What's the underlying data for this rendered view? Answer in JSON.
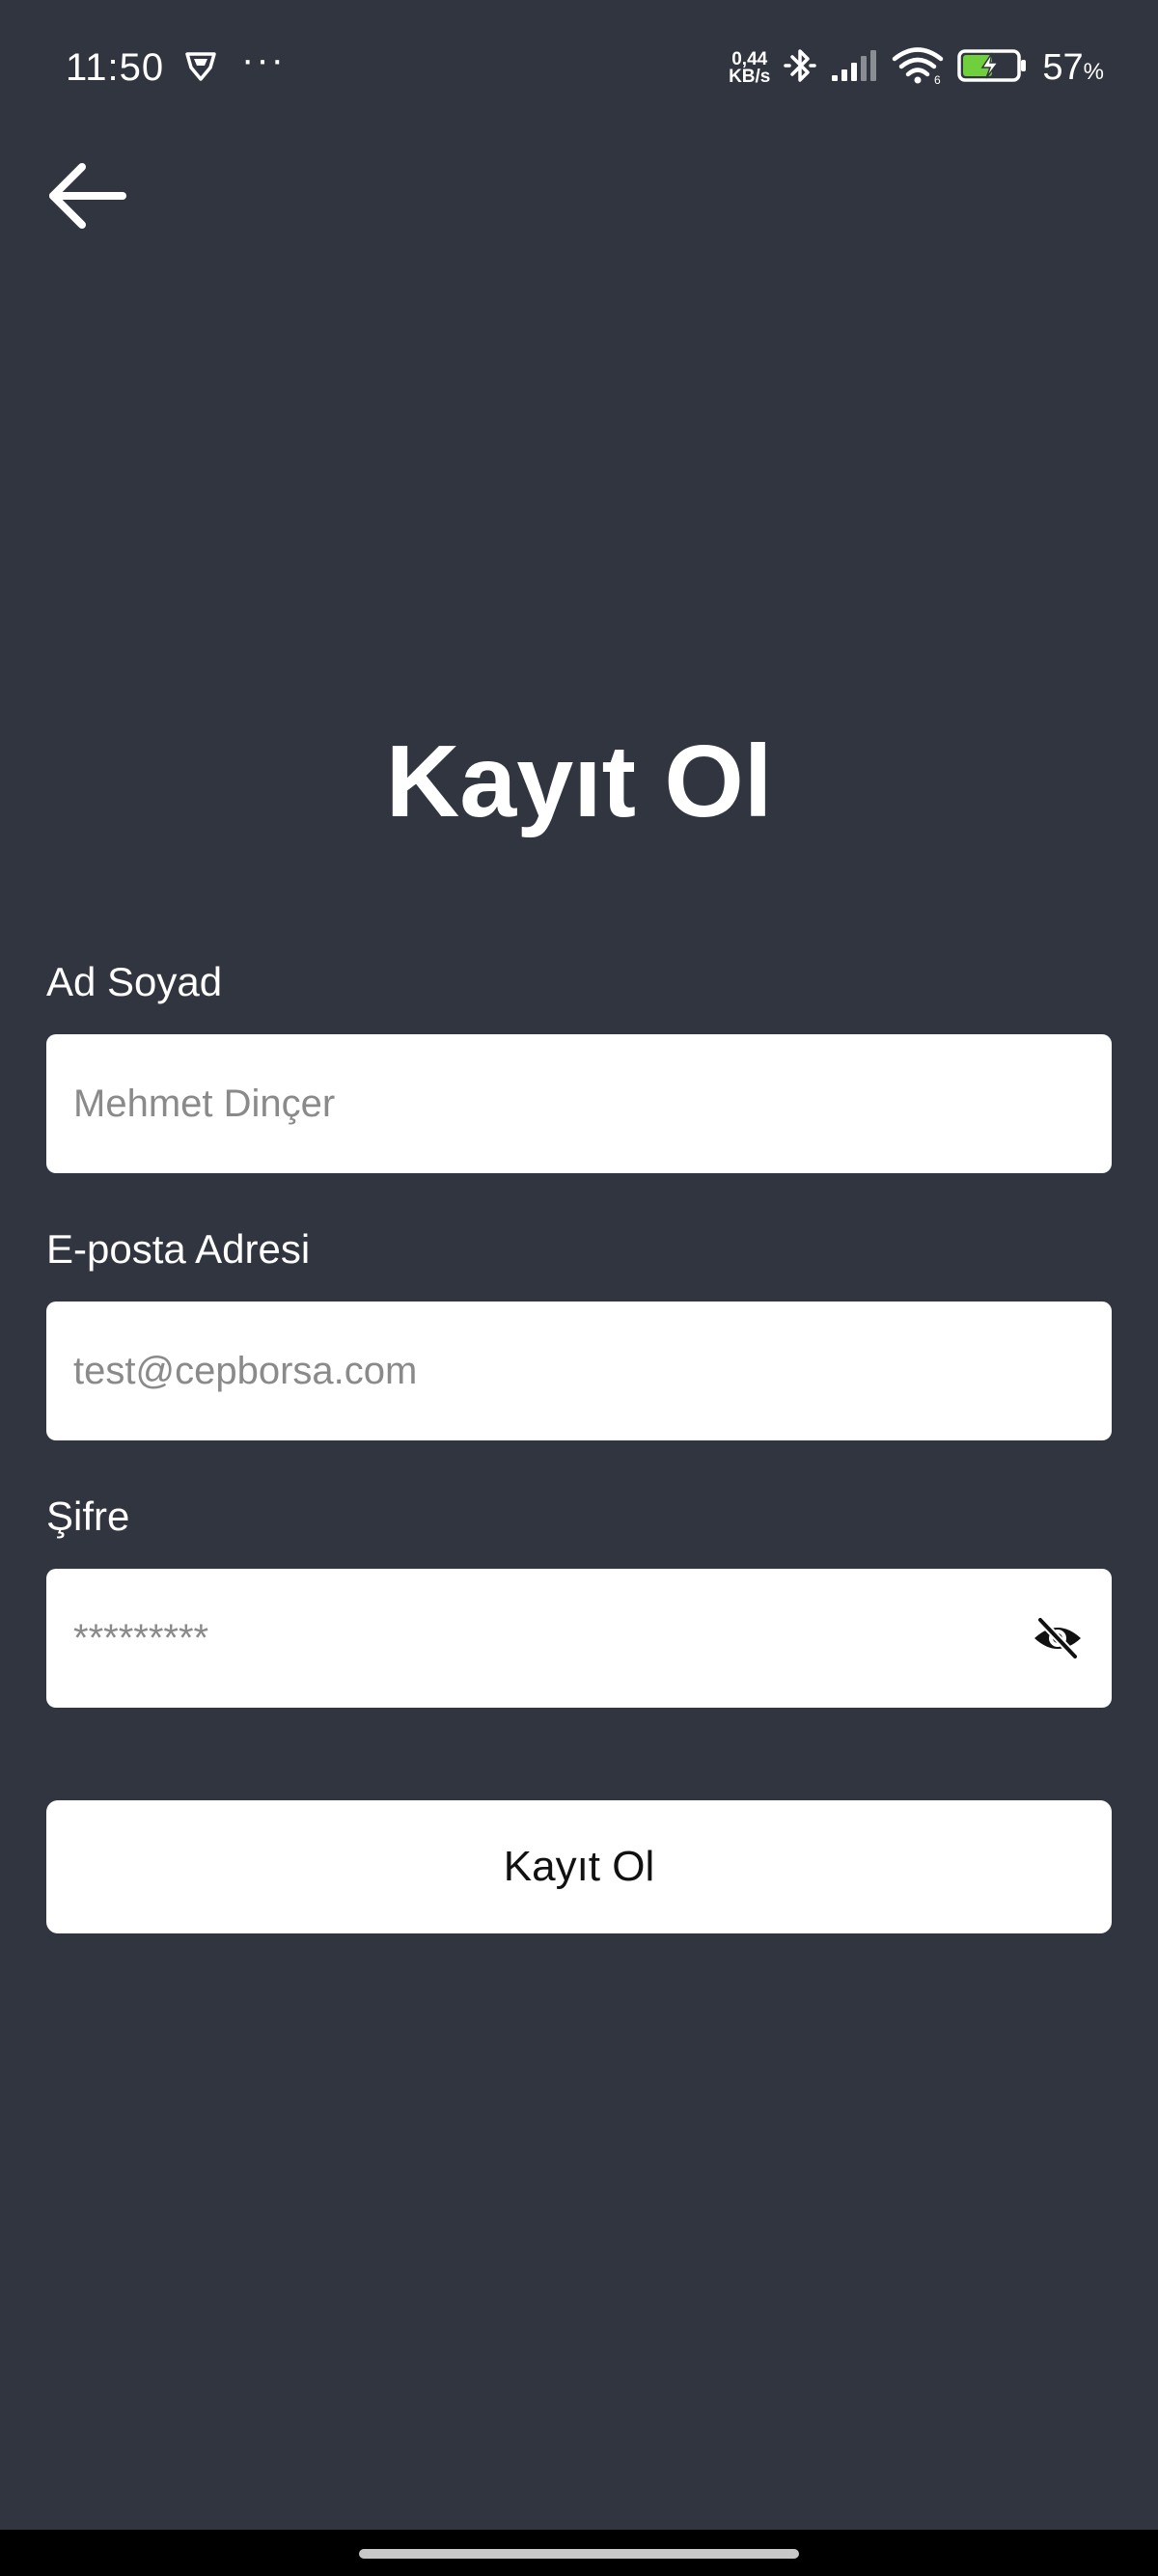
{
  "status_bar": {
    "time": "11:50",
    "net_speed_value": "0,44",
    "net_speed_unit": "KB/s",
    "battery_level": "57",
    "battery_unit": "%",
    "icons": [
      "vpn-shield-icon",
      "more-dots-icon",
      "bluetooth-icon",
      "signal-icon",
      "wifi-icon",
      "battery-charging-icon"
    ]
  },
  "header": {
    "back_icon": "arrow-left-icon"
  },
  "page": {
    "title": "Kayıt Ol"
  },
  "form": {
    "name": {
      "label": "Ad Soyad",
      "value": "",
      "placeholder": "Mehmet Dinçer"
    },
    "email": {
      "label": "E-posta Adresi",
      "value": "",
      "placeholder": "test@cepborsa.com"
    },
    "password": {
      "label": "Şifre",
      "value": "",
      "placeholder": "*********",
      "toggle_icon": "eye-off-icon"
    },
    "submit_label": "Kayıt Ol"
  },
  "colors": {
    "background": "#31353f",
    "input_background": "#ffffff",
    "text": "#ffffff",
    "battery_charge": "#6fcf3c"
  }
}
